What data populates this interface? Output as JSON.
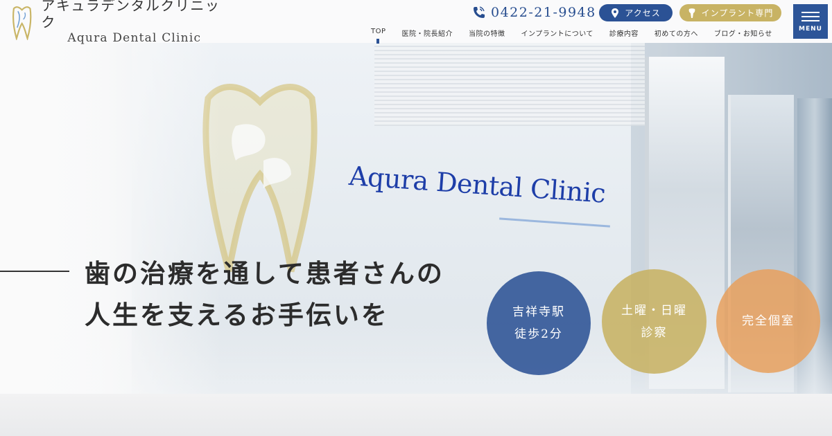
{
  "header": {
    "logo_jp": "アキュラデンタルクリニック",
    "logo_en": "Aqura Dental Clinic",
    "phone": "0422-21-9948",
    "access_label": "アクセス",
    "implant_label": "インプラント専門",
    "menu_label": "MENU",
    "nav": [
      {
        "label": "TOP"
      },
      {
        "label": "医院・院長紹介"
      },
      {
        "label": "当院の特徴"
      },
      {
        "label": "インプラントについて"
      },
      {
        "label": "診療内容"
      },
      {
        "label": "初めての方へ"
      },
      {
        "label": "ブログ・お知らせ"
      }
    ]
  },
  "hero": {
    "wall_sign": "Aqura Dental Clinic",
    "tagline_line1": "歯の治療を通して患者さんの",
    "tagline_line2": "人生を支えるお手伝いを",
    "badges": [
      {
        "line1": "吉祥寺駅",
        "line2": "徒歩2分"
      },
      {
        "line1": "土曜・日曜",
        "line2": "診察"
      },
      {
        "line1": "完全個室",
        "line2": ""
      }
    ]
  },
  "colors": {
    "brand_blue": "#2b5295",
    "brand_gold": "#c8b364",
    "brand_orange": "#e8a05d"
  }
}
